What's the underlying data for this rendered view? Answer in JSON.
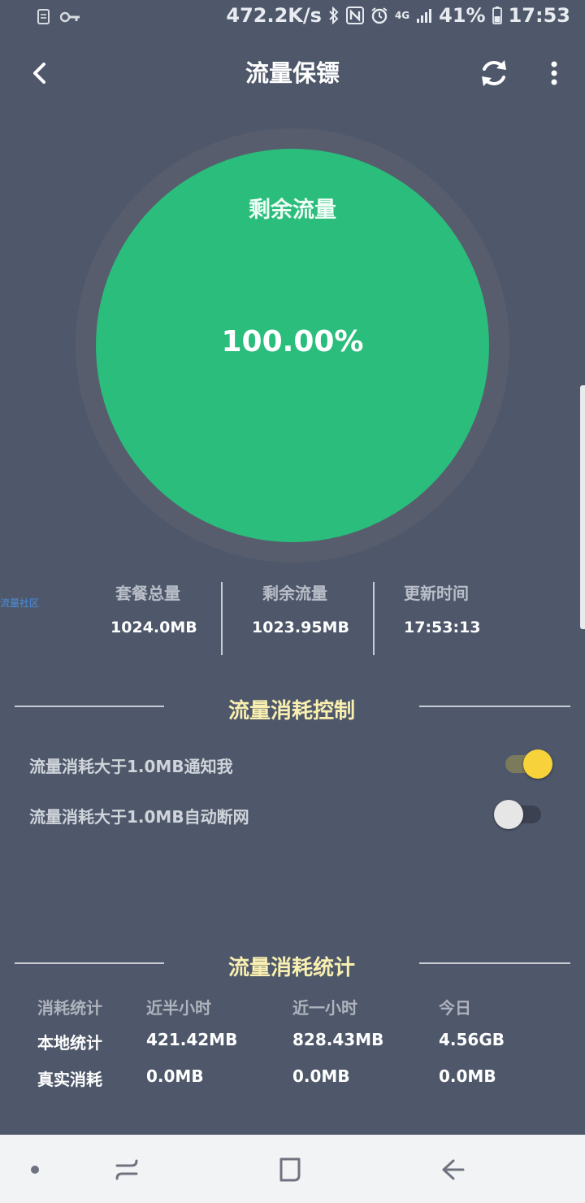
{
  "status_bar": {
    "net_speed": "472.2K/s",
    "network_type": "4G",
    "battery": "41%",
    "time": "17:53",
    "left_icons": [
      "sim-file-icon",
      "key-icon"
    ],
    "right_icons": [
      "bluetooth-icon",
      "nfc-icon",
      "alarm-icon",
      "signal-icon",
      "battery-icon"
    ]
  },
  "header": {
    "title": "流量保镖",
    "icons": [
      "back-arrow-icon",
      "refresh-icon",
      "more-vertical-icon"
    ]
  },
  "gauge": {
    "label": "剩余流量",
    "value": "100.00%",
    "colors": {
      "fill": "#2bbd7c",
      "ring": "#575d6d"
    }
  },
  "watermark": "流量社区",
  "stats": [
    {
      "label": "套餐总量",
      "value": "1024.0MB"
    },
    {
      "label": "剩余流量",
      "value": "1023.95MB"
    },
    {
      "label": "更新时间",
      "value": "17:53:13"
    }
  ],
  "control": {
    "title": "流量消耗控制",
    "settings": [
      {
        "label": "流量消耗大于1.0MB通知我",
        "enabled": true
      },
      {
        "label": "流量消耗大于1.0MB自动断网",
        "enabled": false
      }
    ],
    "colors": {
      "toggle_on": "#f7d23a",
      "toggle_off": "#e6e6e6"
    }
  },
  "statistics": {
    "title": "流量消耗统计",
    "headers": [
      "消耗统计",
      "近半小时",
      "近一小时",
      "今日"
    ],
    "rows": [
      [
        "本地统计",
        "421.42MB",
        "828.43MB",
        "4.56GB"
      ],
      [
        "真实消耗",
        "0.0MB",
        "0.0MB",
        "0.0MB"
      ]
    ]
  },
  "navbar": {
    "icons": [
      "home-dot-icon",
      "recents-icon",
      "overview-icon",
      "back-icon"
    ]
  }
}
